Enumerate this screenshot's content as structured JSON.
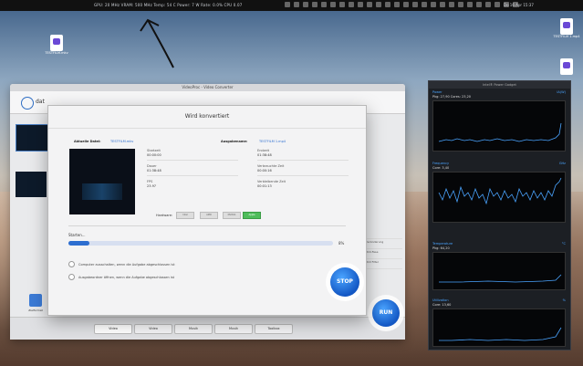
{
  "menubar": {
    "stats": "GPU: 20 MHz  VRAM: 500 MHz  Temp: 54 C  Power: 7 W  Rate: 0.0%  CPU 0.07",
    "clock": "Do 16 Apr 15:37"
  },
  "desktop": {
    "icon_left_label": "TESTFILM.mkv",
    "icon_right_label": "TESTFILM 1.mp4"
  },
  "converter": {
    "window_title": "VideoProc - Video Converter",
    "toolbar_text": "dat",
    "side_button_label": "Zielformat",
    "right_list": [
      "",
      "Veränderung",
      "Bild-Fase",
      "Bild Filter"
    ],
    "bottom_tabs": [
      "Video",
      "Video",
      "Musik",
      "Musik",
      "Toolbox"
    ],
    "run_label": "RUN"
  },
  "dialog": {
    "title": "Wird konvertiert",
    "source_label": "Aktuelle Datei:",
    "source_value": "TESTFILM.mkv",
    "dest_label": "Ausgabename:",
    "dest_value": "TESTFILM 1.mp4",
    "left_meta": [
      {
        "label": "Startzeit",
        "value": "00:00:00"
      },
      {
        "label": "Dauer",
        "value": "01:38:48"
      },
      {
        "label": "FPS",
        "value": "23.97"
      }
    ],
    "right_meta": [
      {
        "label": "Endzeit",
        "value": "01:38:48"
      },
      {
        "label": "Verbrauchte Zeit",
        "value": "00:00:16"
      },
      {
        "label": "Verbleibende Zeit",
        "value": "00:01:13"
      }
    ],
    "hardware_label": "Hardware:",
    "hardware_options": [
      "Intel",
      "AMD",
      "NVIDIA",
      "Apple"
    ],
    "hardware_active": "Apple",
    "status_text": "Starten...",
    "progress": 0.08,
    "progress_text": "8%",
    "option_shutdown": "Computer ausschalten, wenn die Aufgabe abgeschlossen ist",
    "option_open_folder": "Ausgabeordner öffnen, wenn die Aufgabe abgeschlossen ist",
    "stop_label": "STOP"
  },
  "power_gadget": {
    "title": "Intel® Power Gadget",
    "sections": [
      {
        "name": "Power",
        "vals": "Pkg: 27,90   Cores: 23,20",
        "right": "IA(W)"
      },
      {
        "name": "Frequency",
        "vals": "Core: 3,40",
        "right": "GHz"
      },
      {
        "name": "Temperature",
        "vals": "Pkg: 64,20",
        "right": "°C"
      },
      {
        "name": "Utilization",
        "vals": "Core: 13,60",
        "right": "%"
      }
    ]
  }
}
